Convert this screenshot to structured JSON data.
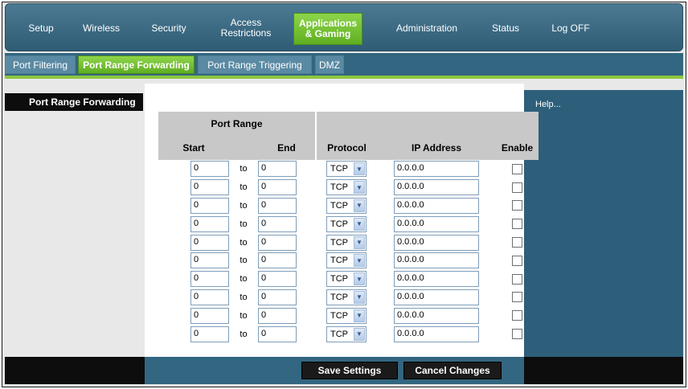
{
  "topnav": {
    "items": [
      {
        "label": "Setup"
      },
      {
        "label": "Wireless"
      },
      {
        "label": "Security"
      },
      {
        "line1": "Access",
        "line2": "Restrictions"
      },
      {
        "line1": "Applications",
        "line2": "& Gaming"
      },
      {
        "label": "Administration"
      },
      {
        "label": "Status"
      },
      {
        "label": "Log OFF"
      }
    ]
  },
  "subnav": {
    "items": [
      {
        "label": "Port Filtering"
      },
      {
        "label": "Port Range Forwarding"
      },
      {
        "label": "Port Range Triggering"
      },
      {
        "label": "DMZ"
      }
    ]
  },
  "sidebar": {
    "title": "Port Range Forwarding"
  },
  "help": {
    "label": "Help..."
  },
  "table": {
    "group_header": "Port Range",
    "headers": [
      "Start",
      "End",
      "Protocol",
      "IP Address",
      "Enable"
    ],
    "separator": "to",
    "rows": [
      {
        "start": "0",
        "end": "0",
        "protocol": "TCP",
        "ip": "0.0.0.0"
      },
      {
        "start": "0",
        "end": "0",
        "protocol": "TCP",
        "ip": "0.0.0.0"
      },
      {
        "start": "0",
        "end": "0",
        "protocol": "TCP",
        "ip": "0.0.0.0"
      },
      {
        "start": "0",
        "end": "0",
        "protocol": "TCP",
        "ip": "0.0.0.0"
      },
      {
        "start": "0",
        "end": "0",
        "protocol": "TCP",
        "ip": "0.0.0.0"
      },
      {
        "start": "0",
        "end": "0",
        "protocol": "TCP",
        "ip": "0.0.0.0"
      },
      {
        "start": "0",
        "end": "0",
        "protocol": "TCP",
        "ip": "0.0.0.0"
      },
      {
        "start": "0",
        "end": "0",
        "protocol": "TCP",
        "ip": "0.0.0.0"
      },
      {
        "start": "0",
        "end": "0",
        "protocol": "TCP",
        "ip": "0.0.0.0"
      },
      {
        "start": "0",
        "end": "0",
        "protocol": "TCP",
        "ip": "0.0.0.0"
      }
    ]
  },
  "buttons": {
    "save": "Save Settings",
    "cancel": "Cancel Changes"
  },
  "colors": {
    "nav_blue": "#336680",
    "active_green": "#6fbf2e",
    "help_bg": "#2e5f7a"
  }
}
